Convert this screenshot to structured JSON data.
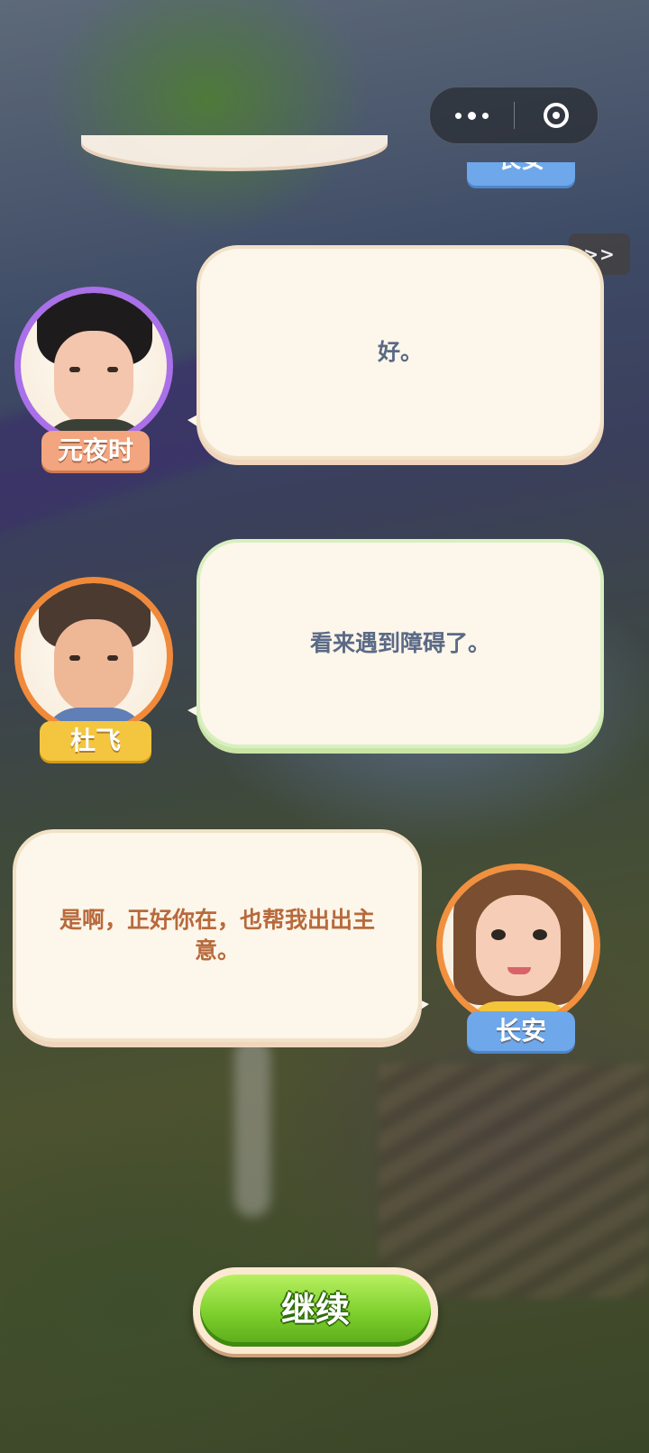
{
  "capsule": {
    "more_icon": "more-dots-icon",
    "close_icon": "target-close-icon"
  },
  "skip_label": ">>",
  "partial_tag_label": "长安",
  "dialogue": [
    {
      "speaker": "元夜时",
      "text": "好。",
      "side": "left",
      "accent": "#a970e8",
      "tag_color": "#f2a57e",
      "text_color": "#5a6a86"
    },
    {
      "speaker": "杜飞",
      "text": "看来遇到障碍了。",
      "side": "left",
      "accent": "#f08a3a",
      "tag_color": "#f4c640",
      "text_color": "#5a6a86"
    },
    {
      "speaker": "长安",
      "text": "是啊，正好你在，也帮我出出主意。",
      "side": "right",
      "accent": "#f1903e",
      "tag_color": "#6ea8ea",
      "text_color": "#b86a3c"
    }
  ],
  "continue_label": "继续"
}
